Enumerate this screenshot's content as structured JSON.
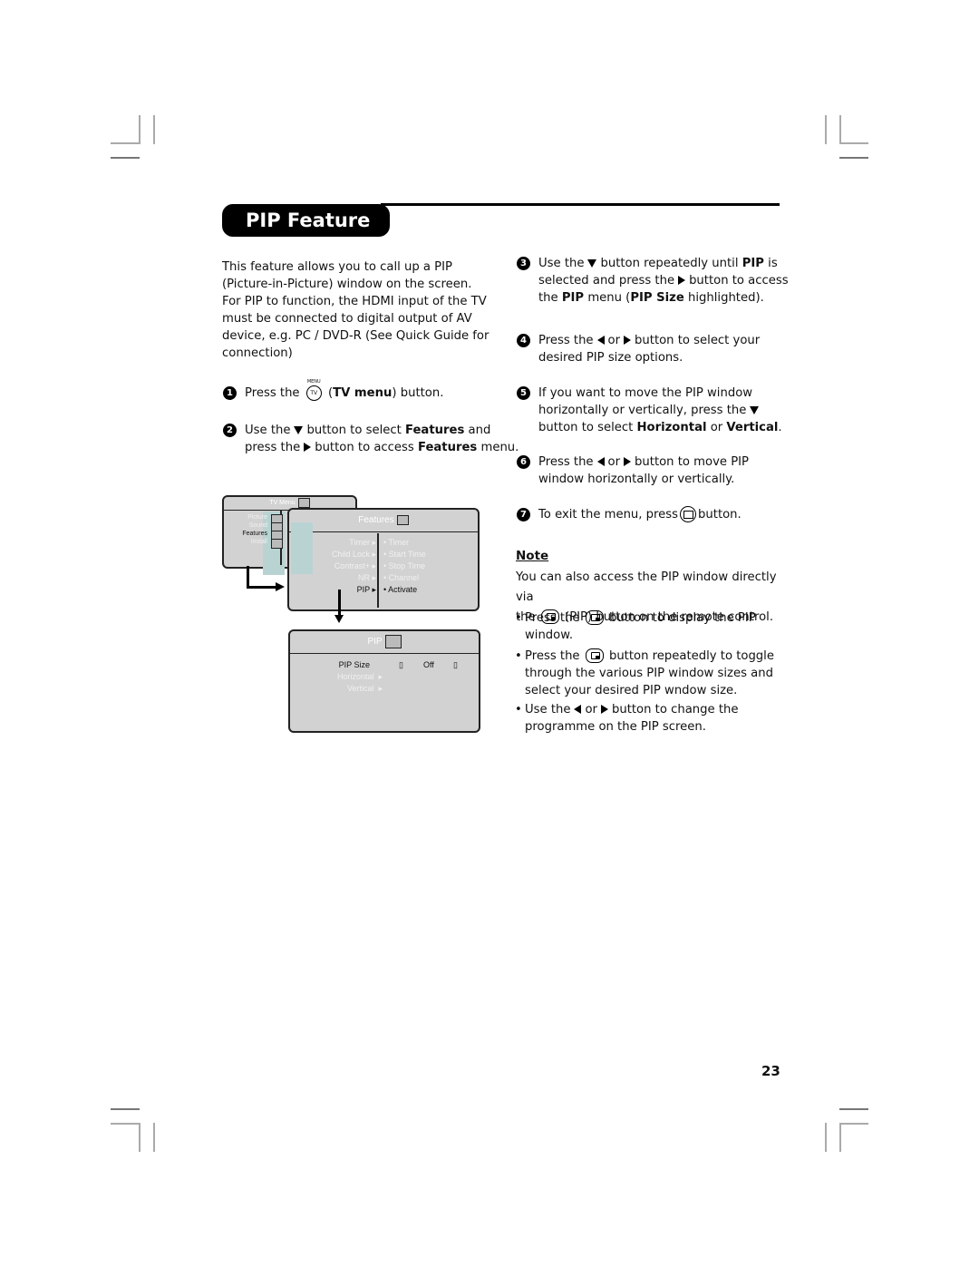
{
  "page": {
    "title": "PIP Feature",
    "page_number": "23"
  },
  "intro": {
    "lines": [
      "This feature allows you to call up a PIP",
      "(Picture-in-Picture) window on the screen.",
      "For PIP to function, the HDMI input of the TV",
      "must be connected to digital output of AV",
      "device, e.g. PC / DVD-R (See Quick Guide for",
      "connection)"
    ]
  },
  "steps": {
    "s1": {
      "num": "1",
      "a": "Press the",
      "btn_menu": "MENU",
      "btn_tv": "TV",
      "b": "(",
      "bold": "TV menu",
      "c": ") button."
    },
    "s2": {
      "num": "2",
      "a": "Use the",
      "b": "button to select",
      "bold1": "Features",
      "c": "and",
      "d": "press the",
      "e": "button to access",
      "bold2": "Features",
      "f": "menu."
    },
    "s3": {
      "num": "3",
      "a": "Use the",
      "b": "button repeatedly until",
      "bold1": "PIP",
      "c": "is",
      "d": "selected and press the",
      "e": "button to access",
      "f": "the",
      "bold2": "PIP",
      "g": "menu (",
      "bold3": "PIP Size",
      "h": "highlighted)."
    },
    "s4": {
      "num": "4",
      "a": "Press the",
      "b": "or",
      "c": "button to select your",
      "d": "desired PIP size options."
    },
    "s5": {
      "num": "5",
      "a": "If you want to move the PIP window",
      "b": "horizontally or vertically, press the",
      "c": "button to select",
      "bold1": "Horizontal",
      "d": "or",
      "bold2": "Vertical",
      "e": "."
    },
    "s6": {
      "num": "6",
      "a": "Press the",
      "b": "or",
      "c": "button to move PIP",
      "d": "window horizontally or vertically."
    },
    "s7": {
      "num": "7",
      "a": "To exit the menu, press",
      "b": "button."
    }
  },
  "note": {
    "heading": "Note",
    "line1": "You can also access the PIP window directly via",
    "line2a": "the",
    "line2b": "(PIP) button on the remote control.",
    "b1a": "Press the",
    "b1b": "button to display the PIP",
    "b1c": "window.",
    "b2a": "Press the",
    "b2b": "button repeatedly to toggle",
    "b2c": "through the various PIP window sizes and",
    "b2d": "select your desired PIP wndow size.",
    "b3a": "Use the",
    "b3b": "or",
    "b3c": "button to change the",
    "b3d": "programme on the PIP screen."
  },
  "tv_menu": {
    "title": "TV Menu",
    "items": [
      "Picture",
      "Sound",
      "Features",
      "Install"
    ]
  },
  "features_menu": {
    "title": "Features",
    "items": [
      "Timer",
      "Child Lock",
      "Contrast+",
      "NR",
      "PIP"
    ],
    "subitems": [
      "Timer",
      "Start Time",
      "Stop Time",
      "Channel",
      "Activate"
    ]
  },
  "pip_menu": {
    "title": "PIP",
    "items": [
      "PIP Size",
      "Horizontal",
      "Vertical"
    ],
    "size_value": "Off"
  }
}
